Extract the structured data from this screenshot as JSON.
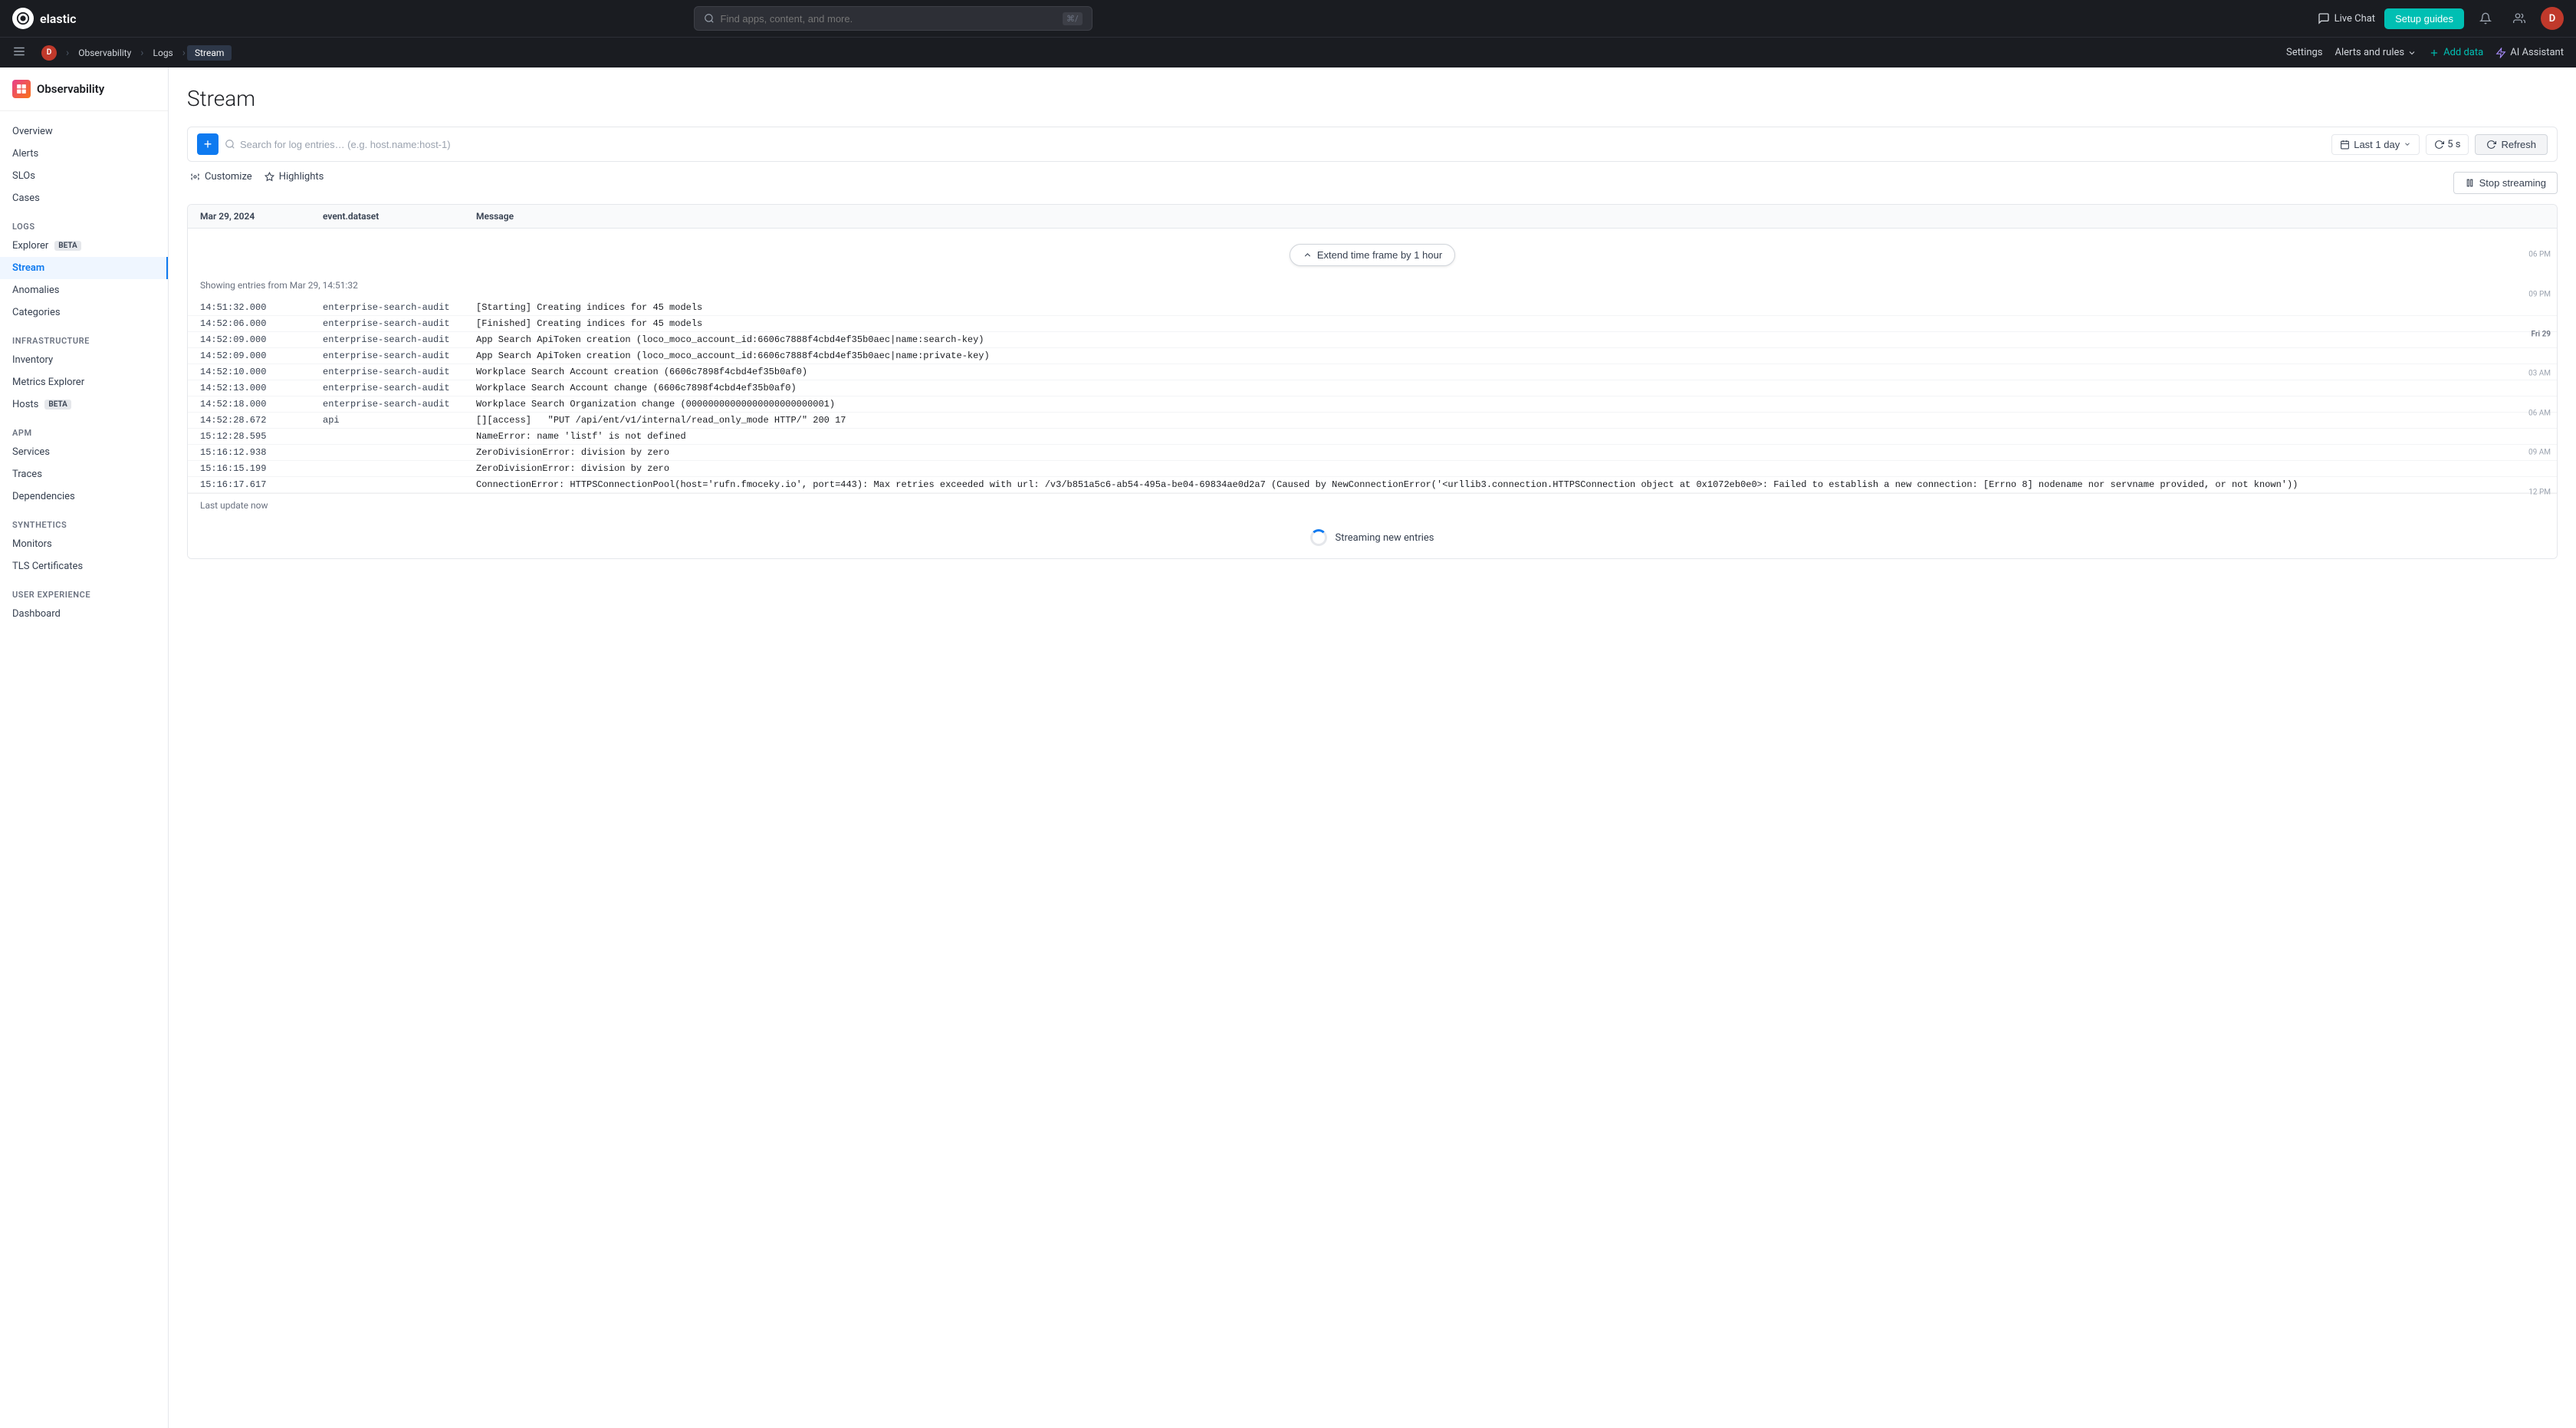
{
  "topnav": {
    "logo_text": "elastic",
    "search_placeholder": "Find apps, content, and more.",
    "search_shortcut": "⌘/",
    "live_chat": "Live Chat",
    "setup_guides": "Setup guides",
    "avatar_initial": "D"
  },
  "breadcrumb": {
    "items": [
      {
        "label": "D",
        "type": "avatar"
      },
      {
        "label": "Observability"
      },
      {
        "label": "Logs"
      },
      {
        "label": "Stream",
        "active": true
      }
    ],
    "settings": "Settings",
    "alerts_rules": "Alerts and rules",
    "add_data": "Add data",
    "ai_assistant": "AI Assistant"
  },
  "sidebar": {
    "brand": "Observability",
    "sections": [
      {
        "items": [
          {
            "label": "Overview",
            "key": "overview"
          },
          {
            "label": "Alerts",
            "key": "alerts"
          },
          {
            "label": "SLOs",
            "key": "slos"
          },
          {
            "label": "Cases",
            "key": "cases"
          }
        ]
      },
      {
        "header": "Logs",
        "items": [
          {
            "label": "Explorer",
            "key": "explorer",
            "badge": "BETA"
          },
          {
            "label": "Stream",
            "key": "stream",
            "active": true
          },
          {
            "label": "Anomalies",
            "key": "anomalies"
          },
          {
            "label": "Categories",
            "key": "categories"
          }
        ]
      },
      {
        "header": "Infrastructure",
        "items": [
          {
            "label": "Inventory",
            "key": "inventory"
          },
          {
            "label": "Metrics Explorer",
            "key": "metrics-explorer"
          },
          {
            "label": "Hosts",
            "key": "hosts",
            "badge": "BETA"
          }
        ]
      },
      {
        "header": "APM",
        "items": [
          {
            "label": "Services",
            "key": "services"
          },
          {
            "label": "Traces",
            "key": "traces"
          },
          {
            "label": "Dependencies",
            "key": "dependencies"
          }
        ]
      },
      {
        "header": "Synthetics",
        "items": [
          {
            "label": "Monitors",
            "key": "monitors"
          },
          {
            "label": "TLS Certificates",
            "key": "tls-certificates"
          }
        ]
      },
      {
        "header": "User Experience",
        "items": [
          {
            "label": "Dashboard",
            "key": "dashboard"
          }
        ]
      }
    ]
  },
  "page": {
    "title": "Stream",
    "search_placeholder": "Search for log entries… (e.g. host.name:host-1)",
    "date_range": "Last 1 day",
    "refresh_interval": "5 s",
    "refresh_label": "Refresh",
    "customize_label": "Customize",
    "highlights_label": "Highlights",
    "stop_streaming_label": "Stop streaming",
    "extend_time_frame": "Extend time frame by 1 hour",
    "showing_entries": "Showing entries from Mar 29, 14:51:32",
    "last_update": "Last update now",
    "streaming_label": "Streaming new entries"
  },
  "table": {
    "col_date": "Mar 29, 2024",
    "col_dataset": "event.dataset",
    "col_message": "Message",
    "time_labels": [
      {
        "label": "06 PM",
        "top_pct": 8
      },
      {
        "label": "09 PM",
        "top_pct": 21
      },
      {
        "label": "Fri 29",
        "top_pct": 31
      },
      {
        "label": "03 AM",
        "top_pct": 42
      },
      {
        "label": "06 AM",
        "top_pct": 54
      },
      {
        "label": "09 AM",
        "top_pct": 65
      },
      {
        "label": "12 PM",
        "top_pct": 77
      }
    ],
    "rows": [
      {
        "time": "14:51:32.000",
        "dataset": "enterprise-search-audit",
        "message": "[Starting] Creating indices for 45 models"
      },
      {
        "time": "14:52:06.000",
        "dataset": "enterprise-search-audit",
        "message": "[Finished] Creating indices for 45 models"
      },
      {
        "time": "14:52:09.000",
        "dataset": "enterprise-search-audit",
        "message": "App Search ApiToken creation (loco_moco_account_id:6606c7888f4cbd4ef35b0aec|name:search-key)"
      },
      {
        "time": "14:52:09.000",
        "dataset": "enterprise-search-audit",
        "message": "App Search ApiToken creation (loco_moco_account_id:6606c7888f4cbd4ef35b0aec|name:private-key)"
      },
      {
        "time": "14:52:10.000",
        "dataset": "enterprise-search-audit",
        "message": "Workplace Search Account creation (6606c7898f4cbd4ef35b0af0)"
      },
      {
        "time": "14:52:13.000",
        "dataset": "enterprise-search-audit",
        "message": "Workplace Search Account change (6606c7898f4cbd4ef35b0af0)"
      },
      {
        "time": "14:52:18.000",
        "dataset": "enterprise-search-audit",
        "message": "Workplace Search Organization change (00000000000000000000000001)"
      },
      {
        "time": "14:52:28.672",
        "dataset": "api",
        "message": "[][access]   \"PUT /api/ent/v1/internal/read_only_mode HTTP/\" 200 17"
      },
      {
        "time": "15:12:28.595",
        "dataset": "",
        "message": "NameError: name 'listf' is not defined"
      },
      {
        "time": "15:16:12.938",
        "dataset": "",
        "message": "ZeroDivisionError: division by zero"
      },
      {
        "time": "15:16:15.199",
        "dataset": "",
        "message": "ZeroDivisionError: division by zero"
      },
      {
        "time": "15:16:17.617",
        "dataset": "",
        "message": "ConnectionError: HTTPSConnectionPool(host='rufn.fmoceky.io', port=443): Max retries exceeded with url: /v3/b851a5c6-ab54-495a-be04-69834ae0d2a7 (Caused by NewConnectionError('<urllib3.connection.HTTPSConnection object at 0x1072eb0e0>: Failed to establish a new connection: [Errno 8] nodename nor servname provided, or not known'))"
      }
    ]
  }
}
